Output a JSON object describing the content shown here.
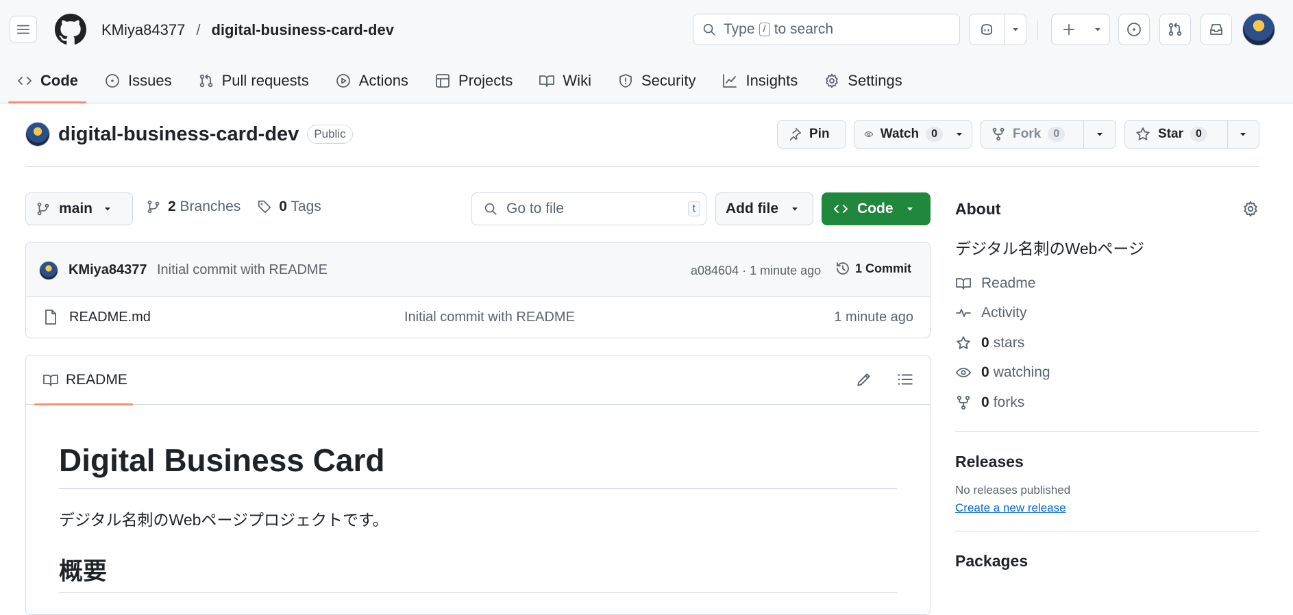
{
  "header": {
    "owner": "KMiya84377",
    "separator": "/",
    "repo": "digital-business-card-dev",
    "search_prefix": "Type",
    "search_key": "/",
    "search_suffix": "to search"
  },
  "nav": {
    "tabs": [
      {
        "label": "Code",
        "icon": "code-icon",
        "active": true
      },
      {
        "label": "Issues",
        "icon": "issue-icon"
      },
      {
        "label": "Pull requests",
        "icon": "pull-request-icon"
      },
      {
        "label": "Actions",
        "icon": "play-icon"
      },
      {
        "label": "Projects",
        "icon": "table-icon"
      },
      {
        "label": "Wiki",
        "icon": "book-icon"
      },
      {
        "label": "Security",
        "icon": "shield-icon"
      },
      {
        "label": "Insights",
        "icon": "graph-icon"
      },
      {
        "label": "Settings",
        "icon": "gear-icon"
      }
    ]
  },
  "repo": {
    "name": "digital-business-card-dev",
    "visibility": "Public",
    "pin_label": "Pin",
    "watch_label": "Watch",
    "watch_count": "0",
    "fork_label": "Fork",
    "fork_count": "0",
    "star_label": "Star",
    "star_count": "0"
  },
  "toolbar": {
    "branch": "main",
    "branches_count": "2",
    "branches_label": "Branches",
    "tags_count": "0",
    "tags_label": "Tags",
    "goto_placeholder": "Go to file",
    "goto_key": "t",
    "add_file_label": "Add file",
    "code_label": "Code"
  },
  "latest_commit": {
    "author": "KMiya84377",
    "message": "Initial commit with README",
    "hash_time": "a084604 · 1 minute ago",
    "commits_label": "1 Commit"
  },
  "files": [
    {
      "name": "README.md",
      "message": "Initial commit with README",
      "time": "1 minute ago"
    }
  ],
  "readme": {
    "tab_label": "README",
    "h1": "Digital Business Card",
    "paragraph": "デジタル名刺のWebページプロジェクトです。",
    "h2": "概要"
  },
  "about": {
    "heading": "About",
    "description": "デジタル名刺のWebページ",
    "readme_label": "Readme",
    "activity_label": "Activity",
    "stars_count": "0",
    "stars_label": "stars",
    "watching_count": "0",
    "watching_label": "watching",
    "forks_count": "0",
    "forks_label": "forks"
  },
  "releases": {
    "heading": "Releases",
    "none_text": "No releases published",
    "create_link": "Create a new release"
  },
  "packages": {
    "heading": "Packages"
  }
}
